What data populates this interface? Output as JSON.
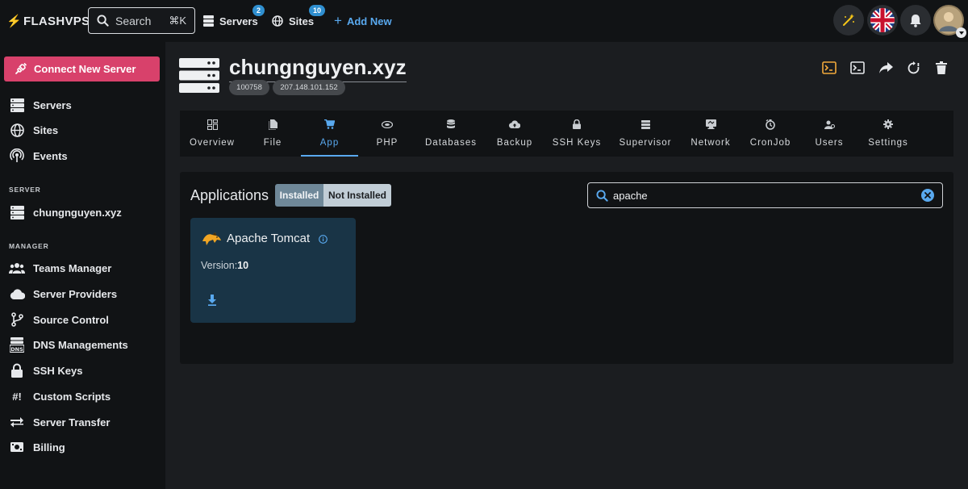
{
  "brand": {
    "name": "FLASHVPS"
  },
  "top": {
    "search_label": "Search",
    "search_shortcut": "⌘K",
    "servers_label": "Servers",
    "servers_count": "2",
    "sites_label": "Sites",
    "sites_count": "10",
    "add_new_label": "Add New"
  },
  "sidebar": {
    "connect_button": "Connect New Server",
    "nav": [
      {
        "label": "Servers",
        "icon": "servers-icon"
      },
      {
        "label": "Sites",
        "icon": "globe-icon"
      },
      {
        "label": "Events",
        "icon": "broadcast-icon"
      }
    ],
    "server_section": "SERVER",
    "server_item": "chungnguyen.xyz",
    "manager_section": "MANAGER",
    "manager": [
      {
        "label": "Teams Manager",
        "icon": "team-icon"
      },
      {
        "label": "Server Providers",
        "icon": "cloud-icon"
      },
      {
        "label": "Source Control",
        "icon": "git-branch-icon"
      },
      {
        "label": "DNS Managements",
        "icon": "dns-icon"
      },
      {
        "label": "SSH Keys",
        "icon": "lock-icon"
      },
      {
        "label": "Custom Scripts",
        "icon": "script-icon"
      },
      {
        "label": "Server Transfer",
        "icon": "transfer-icon"
      },
      {
        "label": "Billing",
        "icon": "billing-icon"
      }
    ]
  },
  "server": {
    "name": "chungnguyen.xyz",
    "id": "100758",
    "ip": "207.148.101.152"
  },
  "tabs": [
    {
      "label": "Overview",
      "icon": "dashboard-icon"
    },
    {
      "label": "File",
      "icon": "file-icon"
    },
    {
      "label": "App",
      "icon": "cart-icon"
    },
    {
      "label": "PHP",
      "icon": "php-icon"
    },
    {
      "label": "Databases",
      "icon": "database-icon"
    },
    {
      "label": "Backup",
      "icon": "cloud-upload-icon"
    },
    {
      "label": "SSH Keys",
      "icon": "lock-icon"
    },
    {
      "label": "Supervisor",
      "icon": "supervisor-icon"
    },
    {
      "label": "Network",
      "icon": "network-icon"
    },
    {
      "label": "CronJob",
      "icon": "cron-icon"
    },
    {
      "label": "Users",
      "icon": "users-icon"
    },
    {
      "label": "Settings",
      "icon": "settings-icon"
    }
  ],
  "active_tab": "App",
  "applications": {
    "title": "Applications",
    "filter_installed": "Installed",
    "filter_not_installed": "Not Installed",
    "search_value": "apache",
    "apps": [
      {
        "name": "Apache Tomcat",
        "version_label": "Version:",
        "version": "10"
      }
    ]
  },
  "colors": {
    "accent": "#59a9ef",
    "connect_button": "#d8416b",
    "badge": "#2f8fd0",
    "card": "#193446"
  }
}
